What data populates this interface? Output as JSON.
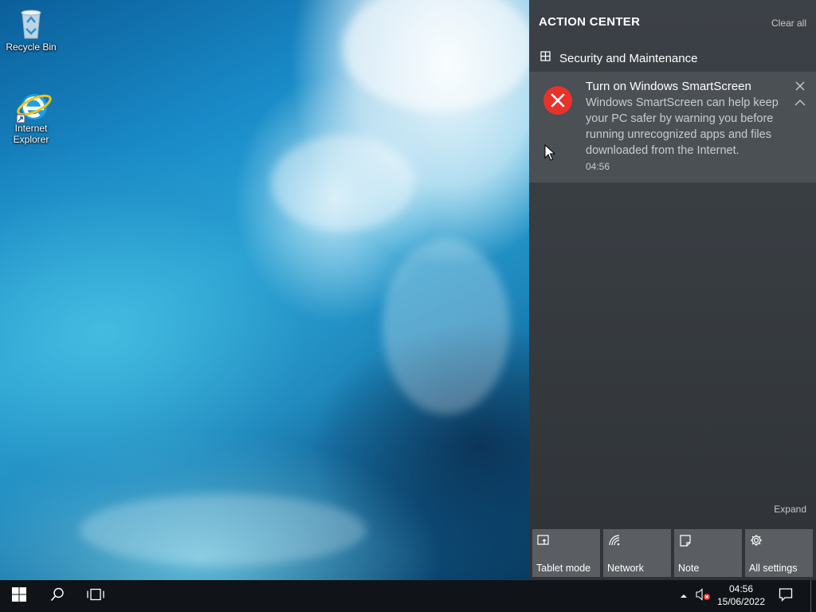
{
  "desktop": {
    "icons": [
      {
        "label": "Recycle Bin",
        "icon": "recycle-bin-icon"
      },
      {
        "label": "Internet\nExplorer",
        "icon": "internet-explorer-icon"
      }
    ]
  },
  "action_center": {
    "title": "ACTION CENTER",
    "clear_all": "Clear all",
    "group": {
      "name": "Security and Maintenance",
      "icon": "security-maintenance-flag-icon"
    },
    "notification": {
      "title": "Turn on Windows SmartScreen",
      "body": "Windows SmartScreen can help keep your PC safer by warning you before running unrecognized apps and files downloaded from the Internet.",
      "time": "04:56",
      "icon": "error-x-icon",
      "icon_color": "#e8322b"
    },
    "expand": "Expand",
    "quick_actions": [
      {
        "label": "Tablet mode",
        "icon": "tablet-mode-icon"
      },
      {
        "label": "Network",
        "icon": "network-icon"
      },
      {
        "label": "Note",
        "icon": "note-icon"
      },
      {
        "label": "All settings",
        "icon": "gear-icon"
      }
    ]
  },
  "taskbar": {
    "clock": {
      "time": "04:56",
      "date": "15/06/2022"
    },
    "icons": [
      "windows-start-icon",
      "search-icon",
      "task-view-icon",
      "show-hidden-icons-chevron",
      "volume-muted-icon",
      "action-center-icon"
    ]
  },
  "colors": {
    "accent_error": "#e8322b",
    "action_center_bg": "#3c4147",
    "notification_bg": "#4b5055",
    "tile_bg": "#5a5e62",
    "taskbar_bg": "#101418"
  }
}
